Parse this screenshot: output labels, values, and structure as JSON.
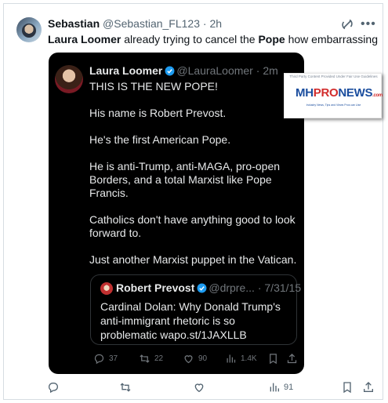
{
  "outer_post": {
    "author_name": "Sebastian",
    "author_handle": "@Sebastian_FL123",
    "separator": " · ",
    "time": "2h",
    "text_parts": [
      {
        "text": "Laura Loomer",
        "bold": true
      },
      {
        "text": " already trying to cancel the ",
        "bold": false
      },
      {
        "text": "Pope",
        "bold": true
      },
      {
        "text": " how embarrassing",
        "bold": false
      }
    ],
    "actions": {
      "reply_count": "",
      "repost_count": "",
      "like_count": "",
      "views_count": "91"
    }
  },
  "embedded_post": {
    "author_name": "Laura Loomer",
    "author_handle": "@LauraLoomer",
    "separator": " · ",
    "time": "2m",
    "body": "THIS IS THE NEW POPE!\n\nHis name is Robert Prevost.\n\nHe's the first American Pope.\n\nHe is anti-Trump, anti-MAGA, pro-open Borders, and a total Marxist like Pope Francis.\n\nCatholics don't have anything good to look forward to.\n\nJust another Marxist puppet in the Vatican.",
    "quoted": {
      "author_name": "Robert Prevost",
      "author_handle": "@drpre...",
      "separator": " · ",
      "time": "7/31/15",
      "body": "Cardinal Dolan: Why Donald Trump's anti-immigrant rhetoric is so problematic wapo.st/1JAXLLB"
    },
    "actions": {
      "reply_count": "37",
      "repost_count": "22",
      "like_count": "90",
      "views_count": "1.4K"
    }
  },
  "watermark": {
    "caption": "Third Party Content Provided Under Fair Use Guidelines",
    "logo_mh": "MH",
    "logo_pro": "PRO",
    "logo_news": "NEWS",
    "logo_com": ".com",
    "tagline": "Industry News, Tips and Views Pros can Use"
  },
  "colors": {
    "verified": "#1d9bf0",
    "dark_card_bg": "#000000",
    "muted_dark": "#71767b",
    "muted_light": "#536471",
    "mhpro_blue": "#1a4d9e",
    "mhpro_red": "#d22c2c"
  }
}
